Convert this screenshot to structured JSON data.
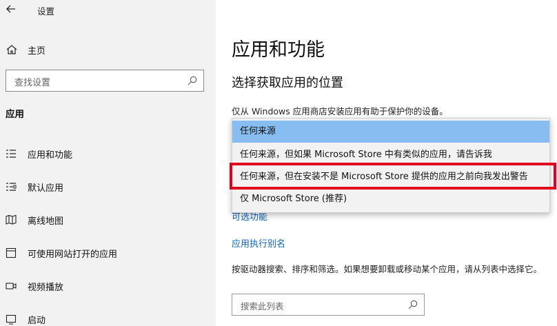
{
  "window": {
    "title": "设置",
    "back_icon": "back-arrow-icon"
  },
  "sidebar": {
    "home_label": "主页",
    "search_placeholder": "查找设置",
    "section_title": "应用",
    "items": [
      {
        "label": "应用和功能",
        "icon": "apps-list-icon"
      },
      {
        "label": "默认应用",
        "icon": "default-apps-icon"
      },
      {
        "label": "离线地图",
        "icon": "map-icon"
      },
      {
        "label": "可使用网站打开的应用",
        "icon": "web-app-icon"
      },
      {
        "label": "视频播放",
        "icon": "video-icon"
      },
      {
        "label": "启动",
        "icon": "startup-icon"
      }
    ]
  },
  "main": {
    "title": "应用和功能",
    "subtitle": "选择获取应用的位置",
    "hint": "仅从 Windows 应用商店安装应用有助于保护你的设备。",
    "links": {
      "optional_features": "可选功能",
      "app_aliases": "应用执行别名"
    },
    "description": "按驱动器搜索、排序和筛选。如果想要卸载或移动某个应用，请从列表中选择它。",
    "search_placeholder": "搜索此列表"
  },
  "dropdown": {
    "selected_index": 0,
    "options": [
      "任何来源",
      "任何来源，但如果 Microsoft Store 中有类似的应用，请告诉我",
      "任何来源，但在安装不是 Microsoft Store 提供的应用之前向我发出警告",
      "仅 Microsoft Store (推荐)"
    ],
    "highlight_color": "#e1001d",
    "selected_color": "#87bdf0"
  },
  "colors": {
    "sidebar_bg": "#f2f2f2",
    "link": "#0a63b8"
  }
}
